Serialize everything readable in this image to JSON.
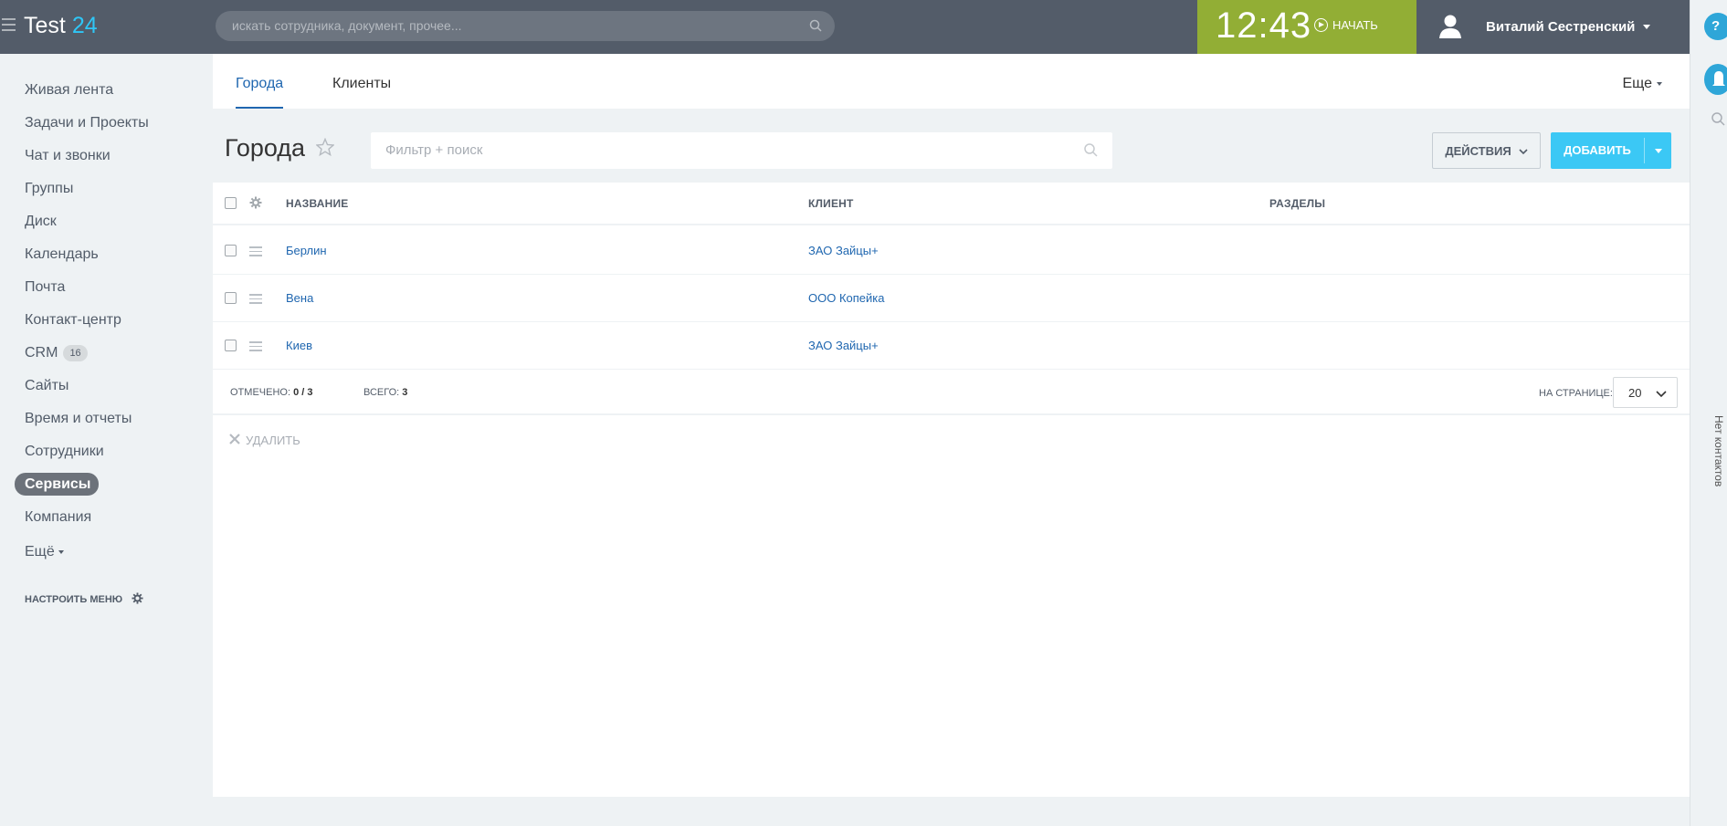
{
  "header": {
    "logo_text": "Test",
    "logo_accent": "24",
    "search_placeholder": "искать сотрудника, документ, прочее...",
    "time": "12:43",
    "start_label": "НАЧАТЬ",
    "user_name": "Виталий Сестренский"
  },
  "right_strip": {
    "help": "?",
    "vertical_text": "Нет контактов"
  },
  "sidebar": {
    "items": [
      {
        "label": "Живая лента"
      },
      {
        "label": "Задачи и Проекты"
      },
      {
        "label": "Чат и звонки"
      },
      {
        "label": "Группы"
      },
      {
        "label": "Диск"
      },
      {
        "label": "Календарь"
      },
      {
        "label": "Почта"
      },
      {
        "label": "Контакт-центр"
      },
      {
        "label": "CRM",
        "counter": "16"
      },
      {
        "label": "Сайты"
      },
      {
        "label": "Время и отчеты"
      },
      {
        "label": "Сотрудники"
      },
      {
        "label": "Сервисы",
        "active": true
      },
      {
        "label": "Компания"
      },
      {
        "label": "Ещё"
      }
    ],
    "configure_label": "НАСТРОИТЬ МЕНЮ"
  },
  "tabs": [
    {
      "label": "Города",
      "active": true
    },
    {
      "label": "Клиенты"
    }
  ],
  "tabs_more": "Еще",
  "page": {
    "title": "Города",
    "filter_placeholder": "Фильтр + поиск",
    "actions_label": "ДЕЙСТВИЯ",
    "add_label": "ДОБАВИТЬ"
  },
  "grid": {
    "columns": [
      "НАЗВАНИЕ",
      "КЛИЕНТ",
      "РАЗДЕЛЫ"
    ],
    "rows": [
      {
        "name": "Берлин",
        "client": "ЗАО Зайцы+",
        "sections": ""
      },
      {
        "name": "Вена",
        "client": "ООО Копейка",
        "sections": ""
      },
      {
        "name": "Киев",
        "client": "ЗАО Зайцы+",
        "sections": ""
      }
    ],
    "selected_label": "ОТМЕЧЕНО:",
    "selected_value": "0 / 3",
    "total_label": "ВСЕГО:",
    "total_value": "3",
    "per_page_label": "НА СТРАНИЦЕ:",
    "per_page_value": "20",
    "delete_label": "УДАЛИТЬ"
  },
  "colors": {
    "header_bg": "#535c69",
    "clock_bg": "#92ae35",
    "accent": "#2fc6f6",
    "link": "#2067b0",
    "add_button": "#3bc8f5"
  }
}
